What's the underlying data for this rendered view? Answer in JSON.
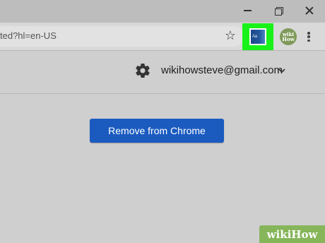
{
  "window": {
    "minimize_glyph": "minimize-icon",
    "restore_glyph": "restore-icon",
    "close_glyph": "close-icon"
  },
  "toolbar": {
    "url_visible": "ted?hl=en-US",
    "bookmark_icon": "star-outline-icon",
    "menu_icon": "vertical-dots-icon"
  },
  "extension": {
    "icon_name": "dictionary-extension-icon",
    "icon_text": "Aa",
    "highlight_color": "#19f219",
    "brand_color": "#1a4a8a"
  },
  "profile": {
    "avatar_text": "wiki\nHow"
  },
  "header": {
    "settings_icon": "gear-icon",
    "account_email": "wikihowsteve@gmail.com",
    "dropdown_icon": "chevron-down-icon"
  },
  "main": {
    "remove_button_label": "Remove from Chrome",
    "button_color": "#1b5bc0"
  },
  "watermark": {
    "text": "wikiHow",
    "color": "#86b55a"
  }
}
